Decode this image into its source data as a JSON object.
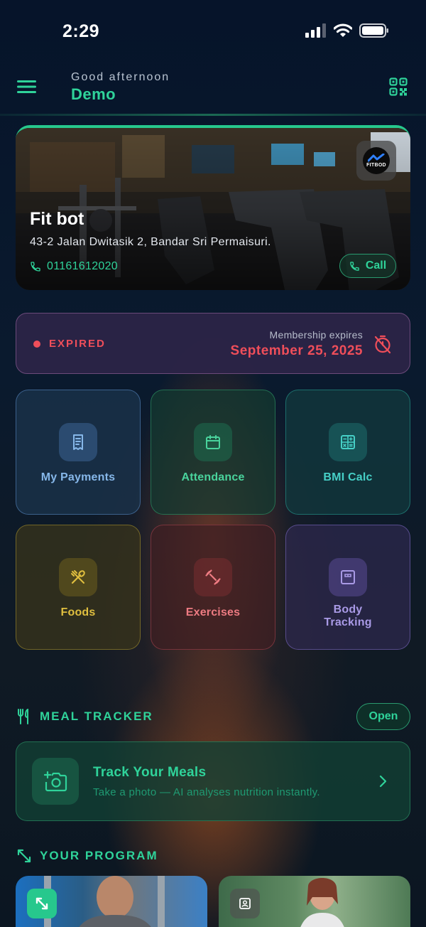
{
  "status_bar": {
    "time": "2:29"
  },
  "header": {
    "greeting": "Good afternoon",
    "user_name": "Demo"
  },
  "gym": {
    "name": "Fit bot",
    "address": "43-2 Jalan Dwitasik 2, Bandar Sri Permaisuri.",
    "phone": "01161612020",
    "call_label": "Call",
    "logo_text": "FITBOD"
  },
  "membership": {
    "status": "EXPIRED",
    "expires_label": "Membership expires",
    "expires_date": "September 25, 2025"
  },
  "tiles": [
    {
      "label": "My Payments",
      "icon": "receipt-icon"
    },
    {
      "label": "Attendance",
      "icon": "calendar-icon"
    },
    {
      "label": "BMI Calc",
      "icon": "calculator-icon"
    },
    {
      "label": "Foods",
      "icon": "utensils-icon"
    },
    {
      "label": "Exercises",
      "icon": "dumbbell-icon"
    },
    {
      "label": "Body Tracking",
      "icon": "scale-icon"
    }
  ],
  "meal_tracker": {
    "section_title": "MEAL TRACKER",
    "open_label": "Open",
    "card_title": "Track Your Meals",
    "card_subtitle": "Take a photo — AI analyses nutrition instantly."
  },
  "program": {
    "section_title": "YOUR PROGRAM"
  },
  "colors": {
    "accent": "#2fd39a",
    "expired": "#ef4e5a",
    "background": "#071224"
  }
}
